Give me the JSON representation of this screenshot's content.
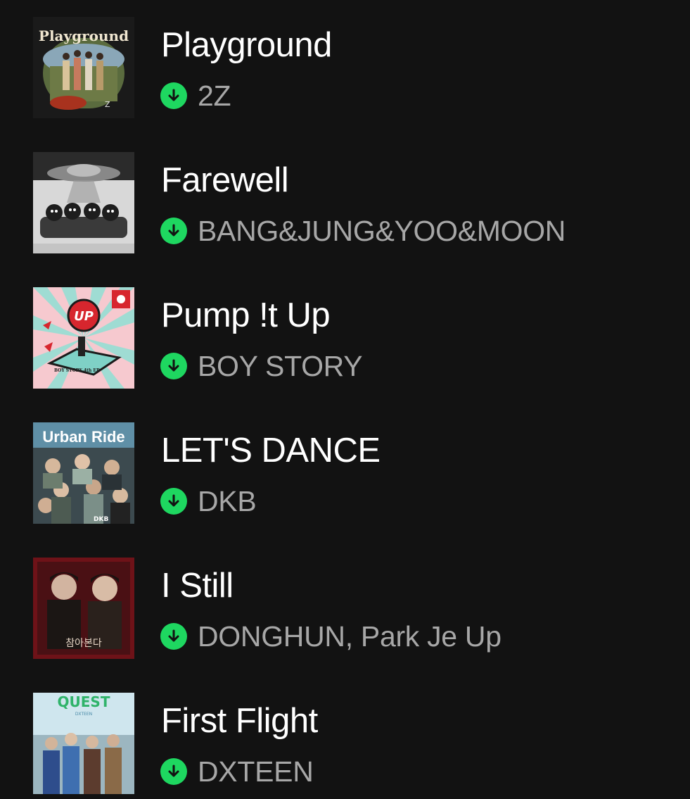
{
  "colors": {
    "background": "#121212",
    "title": "#ffffff",
    "artist": "#a7a7a7",
    "downloaded_badge": "#1ed760"
  },
  "tracks": [
    {
      "title": "Playground",
      "artist": "2Z",
      "downloaded": true,
      "cover": {
        "text": "Playground",
        "icon": "album-cover-playground"
      }
    },
    {
      "title": "Farewell",
      "artist": "BANG&JUNG&YOO&MOON",
      "downloaded": true,
      "cover": {
        "icon": "album-cover-farewell"
      }
    },
    {
      "title": "Pump !t Up",
      "artist": "BOY STORY",
      "downloaded": true,
      "cover": {
        "text": "UP",
        "subtext": "BOY STORY 4th EP",
        "icon": "album-cover-pump-it-up"
      }
    },
    {
      "title": "LET'S DANCE",
      "artist": "DKB",
      "downloaded": true,
      "cover": {
        "text": "Urban Ride",
        "icon": "album-cover-urban-ride"
      }
    },
    {
      "title": "I Still",
      "artist": "DONGHUN, Park Je Up",
      "downloaded": true,
      "cover": {
        "text": "참아본다",
        "icon": "album-cover-i-still"
      }
    },
    {
      "title": "First Flight",
      "artist": "DXTEEN",
      "downloaded": true,
      "cover": {
        "text": "QUEST",
        "subtext": "DXTEEN",
        "icon": "album-cover-quest"
      }
    }
  ]
}
